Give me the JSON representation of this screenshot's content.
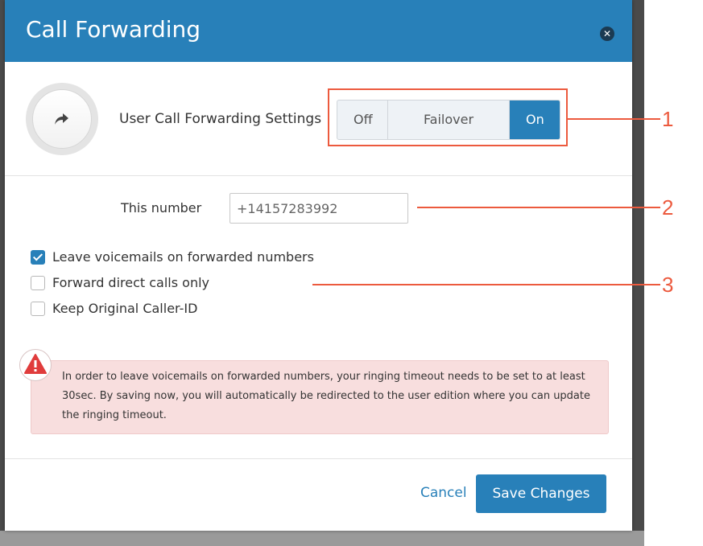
{
  "dialog": {
    "title": "Call Forwarding",
    "close_icon": "close-icon"
  },
  "forwarding": {
    "label": "User Call Forwarding Settings",
    "avatar_icon": "share-arrow-icon",
    "modes": [
      "Off",
      "Failover Mode",
      "On"
    ],
    "selected_mode": "On"
  },
  "number": {
    "label": "This number",
    "value": "+14157283992"
  },
  "options": [
    {
      "label": "Leave voicemails on forwarded numbers",
      "checked": true
    },
    {
      "label": "Forward direct calls only",
      "checked": false
    },
    {
      "label": "Keep Original Caller-ID",
      "checked": false
    }
  ],
  "alert": {
    "icon": "warning-triangle-icon",
    "text": "In order to leave voicemails on forwarded numbers, your ringing timeout needs to be set to at least 30sec. By saving now, you will automatically be redirected to the user edition where you can update the ringing timeout."
  },
  "footer": {
    "cancel_label": "Cancel",
    "save_label": "Save Changes"
  },
  "annotations": [
    "1",
    "2",
    "3"
  ],
  "colors": {
    "accent": "#2880b9",
    "annotation": "#ec5a3e",
    "alert_bg": "#f8dede",
    "warning": "#e03c3c"
  }
}
